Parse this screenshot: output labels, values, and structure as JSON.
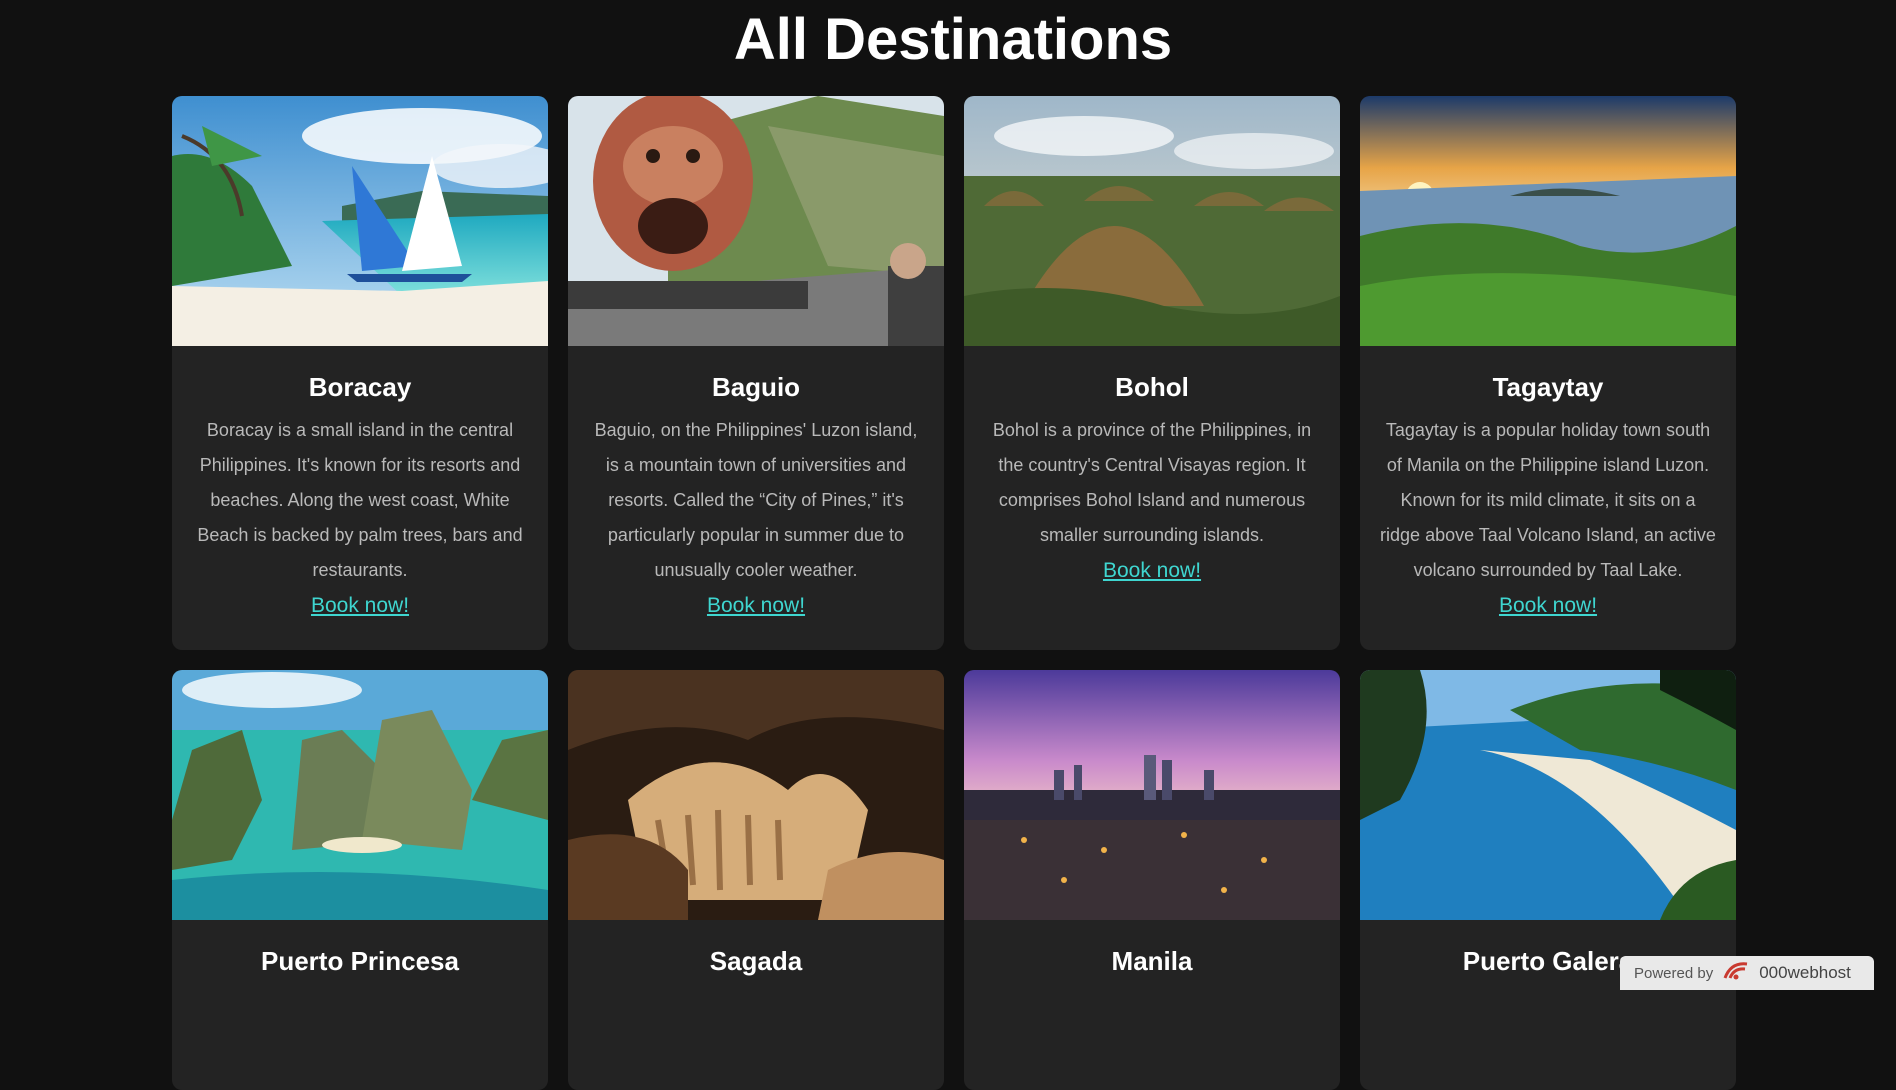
{
  "page": {
    "title": "All Destinations"
  },
  "destinations": [
    {
      "name": "Boracay",
      "description": "Boracay is a small island in the central Philippines. It's known for its resorts and beaches. Along the west coast, White Beach is backed by palm trees, bars and restaurants.",
      "link": "Book now!",
      "image": "beach-sailboats-photo"
    },
    {
      "name": "Baguio",
      "description": "Baguio, on the Philippines' Luzon island, is a mountain town of universities and resorts. Called the “City of Pines,” it's particularly popular in summer due to unusually cooler weather.",
      "link": "Book now!",
      "image": "lion-head-statue-photo"
    },
    {
      "name": "Bohol",
      "description": "Bohol is a province of the Philippines, in the country's Central Visayas region. It comprises Bohol Island and numerous smaller surrounding islands.",
      "link": "Book now!",
      "image": "chocolate-hills-photo"
    },
    {
      "name": "Tagaytay",
      "description": "Tagaytay is a popular holiday town south of Manila on the Philippine island Luzon. Known for its mild climate, it sits on a ridge above Taal Volcano Island, an active volcano surrounded by Taal Lake.",
      "link": "Book now!",
      "image": "lake-sunset-photo"
    },
    {
      "name": "Puerto Princesa",
      "image": "limestone-cliffs-lagoon-photo"
    },
    {
      "name": "Sagada",
      "image": "cave-formations-photo"
    },
    {
      "name": "Manila",
      "image": "city-skyline-dusk-photo"
    },
    {
      "name": "Puerto Galera",
      "image": "beach-cove-aerial-photo"
    }
  ],
  "hosting_badge": {
    "prefix": "Powered by",
    "brand": "000webhost",
    "icon": "000webhost-logo-icon"
  },
  "colors": {
    "background": "#111111",
    "card": "#232323",
    "link": "#3fd6d0",
    "text": "#b9b9b9"
  }
}
